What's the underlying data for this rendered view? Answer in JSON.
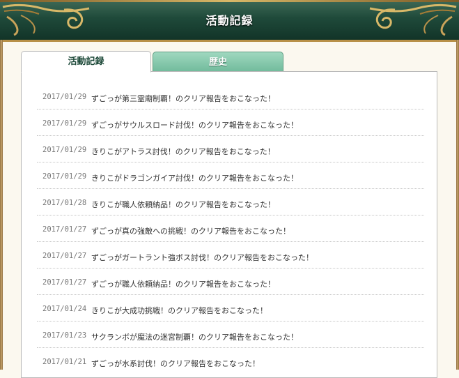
{
  "header": {
    "title": "活動記録"
  },
  "tabs": [
    {
      "label": "活動記録",
      "active": true
    },
    {
      "label": "歴史",
      "active": false
    }
  ],
  "entries": [
    {
      "date": "2017/01/29",
      "text": "ずごっが第三霊廟制覇！のクリア報告をおこなった！"
    },
    {
      "date": "2017/01/29",
      "text": "ずごっがサウルスロード討伐！のクリア報告をおこなった！"
    },
    {
      "date": "2017/01/29",
      "text": "きりこがアトラス討伐！のクリア報告をおこなった！"
    },
    {
      "date": "2017/01/29",
      "text": "きりこがドラゴンガイア討伐！のクリア報告をおこなった！"
    },
    {
      "date": "2017/01/28",
      "text": "きりこが職人依頼納品！のクリア報告をおこなった！"
    },
    {
      "date": "2017/01/27",
      "text": "ずごっが真の強敵への挑戦！のクリア報告をおこなった！"
    },
    {
      "date": "2017/01/27",
      "text": "ずごっがガートラント強ボス討伐！のクリア報告をおこなった！"
    },
    {
      "date": "2017/01/27",
      "text": "ずごっが職人依頼納品！のクリア報告をおこなった！"
    },
    {
      "date": "2017/01/24",
      "text": "きりこが大成功挑戦！のクリア報告をおこなった！"
    },
    {
      "date": "2017/01/23",
      "text": "サクランボが魔法の迷宮制覇！のクリア報告をおこなった！"
    },
    {
      "date": "2017/01/21",
      "text": "ずごっが水系討伐！のクリア報告をおこなった！"
    }
  ],
  "colors": {
    "header_green": "#1f4a3a",
    "gold": "#b89048",
    "tab_inactive": "#7fc4a6"
  },
  "icons": {
    "header_left": "gold-scroll-ornament-icon",
    "header_right": "gold-scroll-ornament-icon"
  }
}
